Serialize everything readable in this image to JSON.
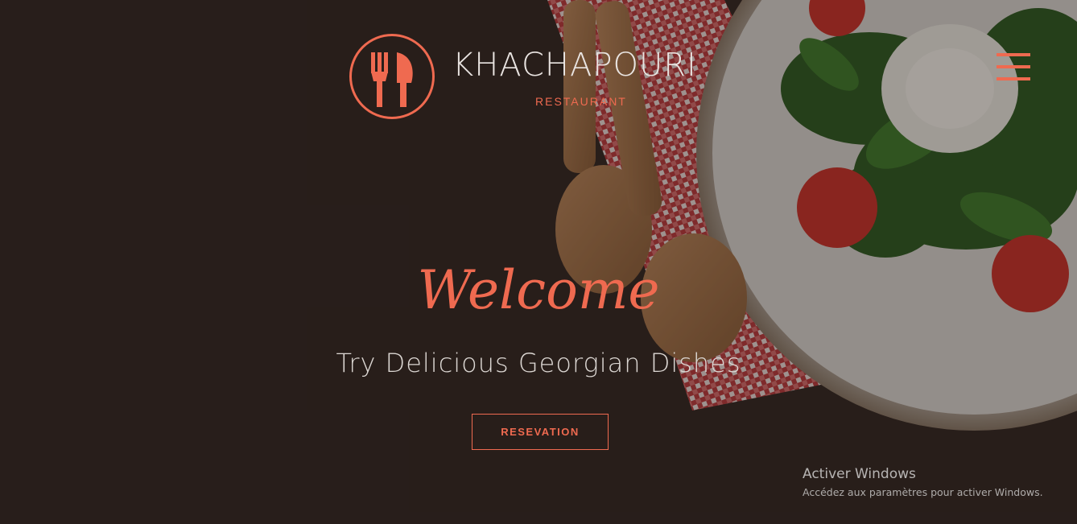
{
  "brand": {
    "name": "KHACHAPOURI",
    "subtitle": "RESTAURANT"
  },
  "menu": {
    "icon": "hamburger-menu-icon"
  },
  "hero": {
    "welcome": "Welcome",
    "tagline": "Try Delicious Georgian Dishes",
    "button_label": "RESEVATION"
  },
  "watermark": {
    "title": "Activer Windows",
    "subtitle": "Accédez aux paramètres pour activer Windows."
  },
  "colors": {
    "accent": "#ef6a50",
    "text_light": "#e9e4e1",
    "wood_dark": "#332723"
  }
}
